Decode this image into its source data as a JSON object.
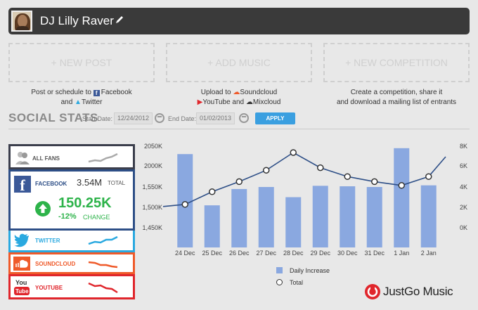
{
  "header": {
    "title": "DJ Lilly Raver"
  },
  "actions": [
    {
      "label": "+ NEW POST"
    },
    {
      "label": "+ ADD MUSIC"
    },
    {
      "label": "+ NEW COMPETITION"
    }
  ],
  "descriptions": {
    "post": {
      "line1_prefix": "Post or schedule to",
      "facebook": "Facebook",
      "and": "and",
      "twitter": "Twitter"
    },
    "music": {
      "prefix": "Upload to",
      "soundcloud": "Soundcloud",
      "youtube": "YouTube",
      "and": "and",
      "mixcloud": "Mixcloud"
    },
    "competition": {
      "line1": "Create a competition, share it",
      "line2": "and download a mailing list of entrants"
    }
  },
  "stats": {
    "title": "SOCIAL STATS",
    "start_label": "Start Date:",
    "start_value": "12/24/2012",
    "end_label": "End Date:",
    "end_value": "01/02/2013",
    "apply_label": "APPLY"
  },
  "cards": {
    "allfans": {
      "label": "ALL FANS"
    },
    "facebook": {
      "label": "FACEBOOK",
      "total": "3.54M",
      "total_label": "TOTAL",
      "big": "150.25K",
      "change": "-12%",
      "change_label": "CHANGE"
    },
    "twitter": {
      "label": "TWITTER"
    },
    "soundcloud": {
      "label": "SOUNDCLOUD"
    },
    "youtube": {
      "label": "YOUTUBE"
    }
  },
  "colors": {
    "bar": "#8aa8e0",
    "line": "#2e4f87",
    "apply": "#3a9fe0",
    "up": "#2db34a"
  },
  "chart_data": {
    "type": "bar",
    "categories": [
      "24 Dec",
      "25 Dec",
      "26 Dec",
      "27 Dec",
      "28 Dec",
      "29 Dec",
      "30 Dec",
      "31 Dec",
      "1 Jan",
      "2 Jan"
    ],
    "y_left_ticks": [
      "2050K",
      "2000K",
      "1,550K",
      "1,500K",
      "1,450K"
    ],
    "y_right_ticks": [
      "8K",
      "6K",
      "4K",
      "2K",
      "0K"
    ],
    "series": [
      {
        "name": "Daily Increase",
        "type": "bar",
        "values": [
          2030,
          1505,
          1545,
          1550,
          1525,
          1575,
          1565,
          1550,
          2045,
          1585
        ]
      },
      {
        "name": "Total",
        "type": "line",
        "values": [
          3.4,
          4.4,
          5.2,
          6.1,
          7.5,
          6.3,
          5.6,
          5.2,
          4.9,
          5.6
        ]
      }
    ],
    "y_right_range": [
      0,
      8
    ]
  }
}
